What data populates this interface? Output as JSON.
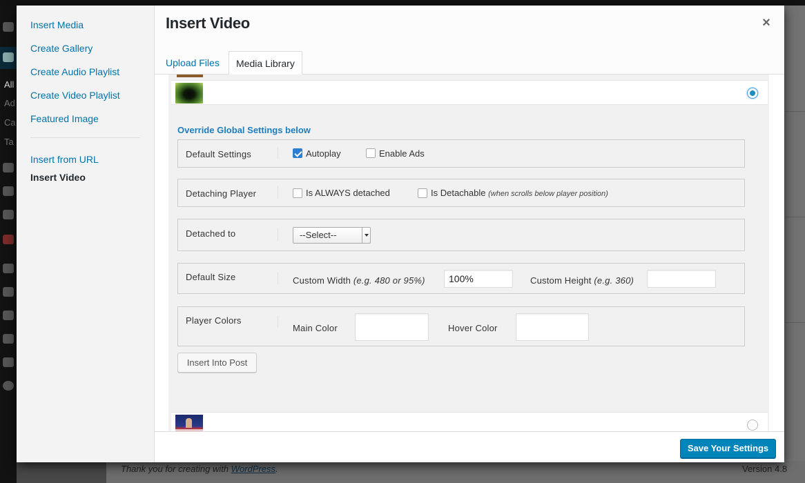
{
  "background": {
    "sidebar_fragments": [
      "All",
      "Ad",
      "Ca",
      "Ta"
    ],
    "footer_text_prefix": "Thank you for creating with ",
    "footer_link": "WordPress",
    "footer_text_suffix": ".",
    "version": "Version 4.8"
  },
  "menu": {
    "items": [
      {
        "label": "Insert Media"
      },
      {
        "label": "Create Gallery"
      },
      {
        "label": "Create Audio Playlist"
      },
      {
        "label": "Create Video Playlist"
      },
      {
        "label": "Featured Image"
      },
      {
        "label": "Insert from URL"
      },
      {
        "label": "Insert Video"
      }
    ],
    "active": "Insert Video"
  },
  "frame": {
    "title": "Insert Video",
    "close_glyph": "×",
    "tabs": [
      {
        "label": "Upload Files"
      },
      {
        "label": "Media Library"
      }
    ],
    "active_tab": "Media Library"
  },
  "settings": {
    "heading": "Override Global Settings below",
    "default_settings": {
      "label": "Default Settings",
      "autoplay": {
        "label": "Autoplay",
        "checked": true
      },
      "enable_ads": {
        "label": "Enable Ads",
        "checked": false
      }
    },
    "detaching_player": {
      "label": "Detaching Player",
      "always_detached": {
        "label": "Is ALWAYS detached",
        "checked": false
      },
      "detachable": {
        "label": "Is Detachable",
        "note": "(when scrolls below player position)",
        "checked": false
      }
    },
    "detached_to": {
      "label": "Detached to",
      "selected": "--Select--"
    },
    "default_size": {
      "label": "Default Size",
      "width_label": "Custom Width",
      "width_hint": "(e.g. 480 or 95%)",
      "width_value": "100%",
      "height_label": "Custom Height",
      "height_hint": "(e.g. 360)",
      "height_value": ""
    },
    "player_colors": {
      "label": "Player Colors",
      "main_label": "Main Color",
      "main_value": "",
      "hover_label": "Hover Color",
      "hover_value": ""
    },
    "insert_button": "Insert Into Post"
  },
  "toolbar": {
    "save_label": "Save Your Settings"
  },
  "colors": {
    "link": "#0073aa",
    "primary_button": "#0085ba",
    "accent_heading": "#1e7dbb",
    "checkbox_checked": "#2b7fd0"
  }
}
